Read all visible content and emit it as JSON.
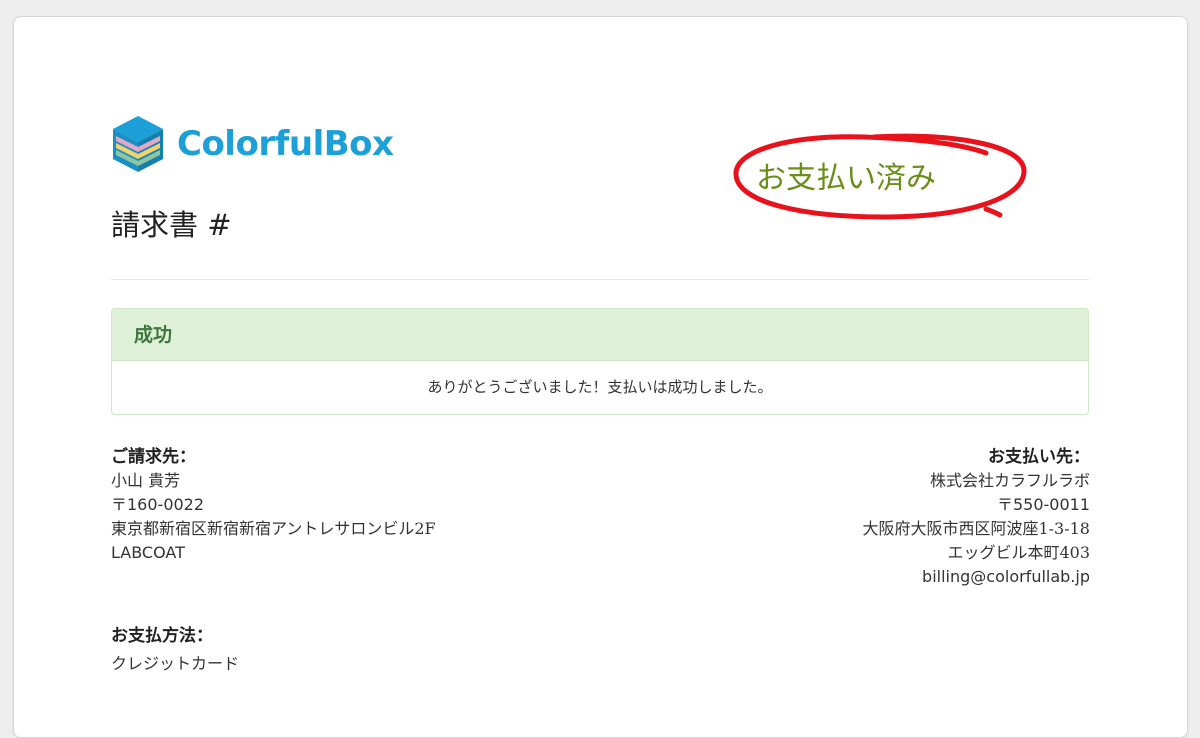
{
  "logo": {
    "brand": "ColorfulBox",
    "icon": "stacked-cube-logo-icon",
    "colors": {
      "top": "#1d9fd8",
      "stripe_pink": "#e6a7c5",
      "stripe_yellow": "#f2d36b",
      "stripe_green": "#8cc6a2",
      "side": "#1a8fc4"
    }
  },
  "invoice": {
    "title": "請求書 #"
  },
  "stamp": {
    "text": "お支払い済み",
    "text_color": "#6b8e1a",
    "circle_color": "#e8121c"
  },
  "alert": {
    "title": "成功",
    "message": "ありがとうございました！支払いは成功しました。"
  },
  "bill_to": {
    "heading": "ご請求先：",
    "name": "小山 貴芳",
    "postal": "〒160-0022",
    "address": "東京都新宿区新宿新宿アントレサロンビル2F",
    "company": "LABCOAT"
  },
  "pay_to": {
    "heading": "お支払い先：",
    "company": "株式会社カラフルラボ",
    "postal": "〒550-0011",
    "address1": "大阪府大阪市西区阿波座1-3-18",
    "address2": "エッグビル本町403",
    "email": "billing@colorfullab.jp"
  },
  "payment_method": {
    "heading": "お支払方法：",
    "value": "クレジットカード"
  }
}
